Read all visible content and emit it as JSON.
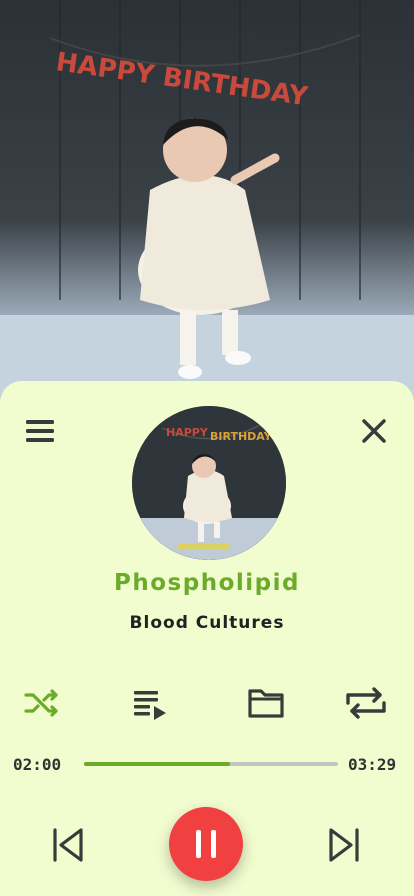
{
  "track": {
    "title": "Phospholipid",
    "artist": "Blood Cultures"
  },
  "cover": {
    "banner_text": "HAPPY BIRTHDAY"
  },
  "progress": {
    "current_time": "02:00",
    "total_time": "03:29",
    "fraction": 0.574
  },
  "colors": {
    "panel_bg": "#f1fccf",
    "accent_green": "#6bab2a",
    "play_red": "#f0403f",
    "icon_dark": "#3a3a3a"
  },
  "icons": {
    "menu": "menu-icon",
    "close": "close-icon",
    "shuffle": "shuffle-icon",
    "queue": "queue-icon",
    "folder": "folder-icon",
    "repeat": "repeat-icon",
    "previous": "skip-previous-icon",
    "pause": "pause-icon",
    "next": "skip-next-icon"
  }
}
